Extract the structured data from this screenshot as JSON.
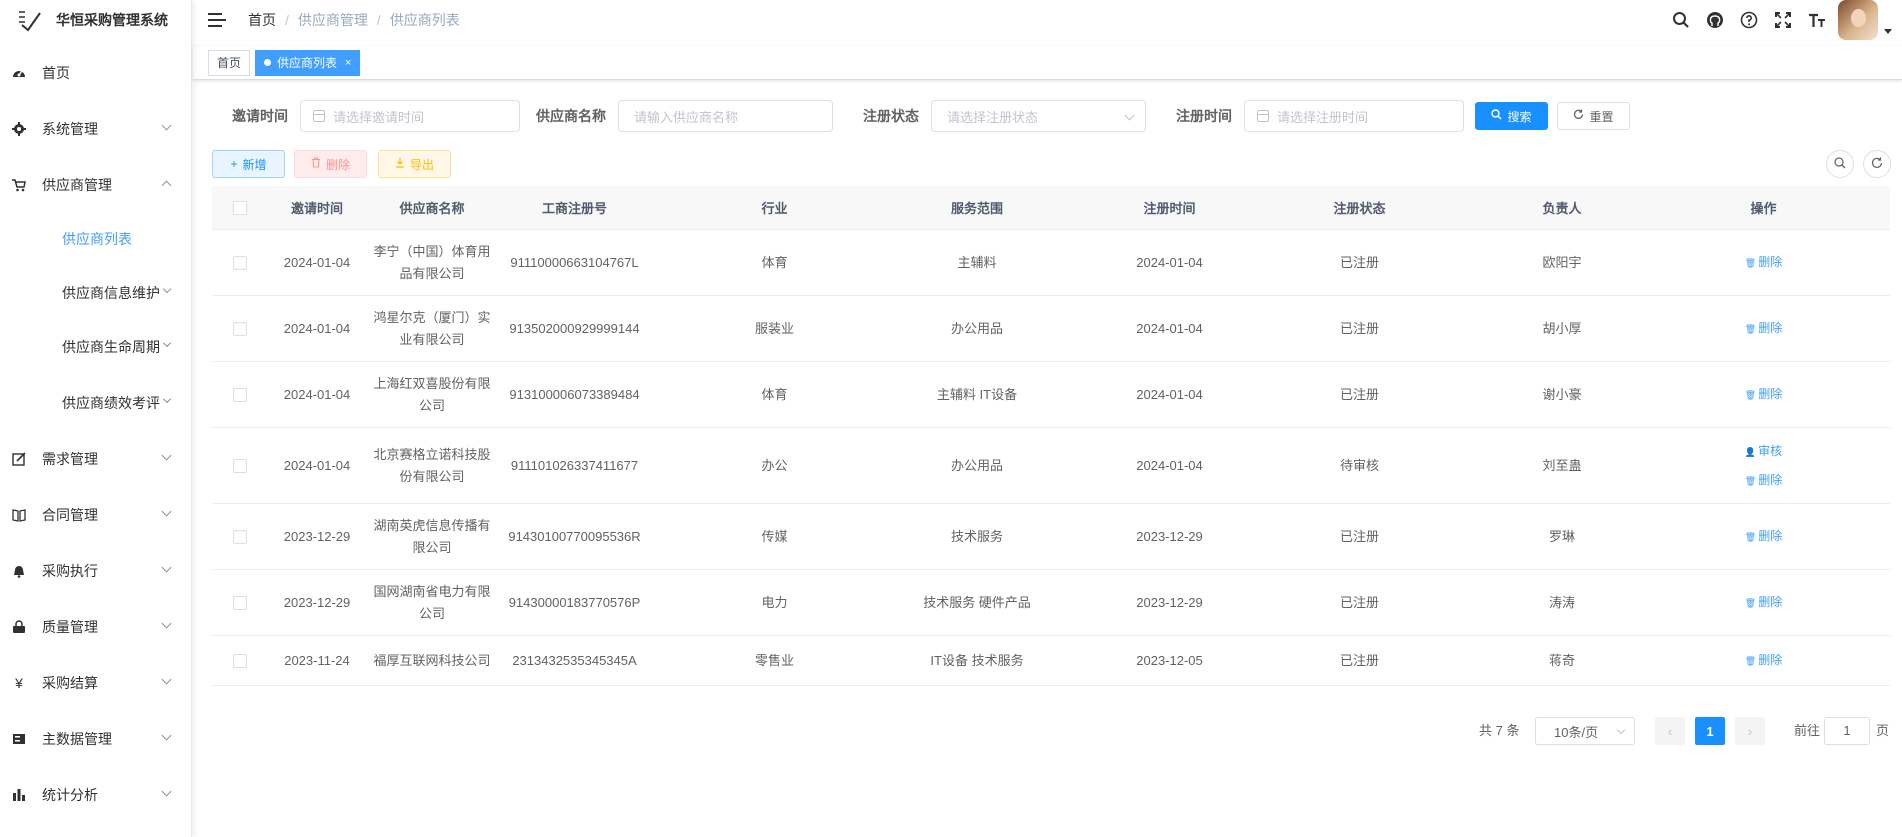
{
  "app": {
    "title": "华恒采购管理系统"
  },
  "sidebar": {
    "items": [
      {
        "label": "首页",
        "icon": "dashboard-icon"
      },
      {
        "label": "系统管理",
        "icon": "gear-icon"
      },
      {
        "label": "供应商管理",
        "icon": "cart-icon"
      },
      {
        "label": "需求管理",
        "icon": "edit-icon"
      },
      {
        "label": "合同管理",
        "icon": "book-icon"
      },
      {
        "label": "采购执行",
        "icon": "bell-icon"
      },
      {
        "label": "质量管理",
        "icon": "lock-icon"
      },
      {
        "label": "采购结算",
        "icon": "yen-icon"
      },
      {
        "label": "主数据管理",
        "icon": "server-icon"
      },
      {
        "label": "统计分析",
        "icon": "bar-chart-icon"
      }
    ],
    "sub_items": [
      {
        "label": "供应商列表"
      },
      {
        "label": "供应商信息维护"
      },
      {
        "label": "供应商生命周期"
      },
      {
        "label": "供应商绩效考评"
      }
    ]
  },
  "header": {
    "breadcrumb": [
      "首页",
      "供应商管理",
      "供应商列表"
    ],
    "breadcrumb_sep": "/"
  },
  "tags": {
    "home": "首页",
    "active": "供应商列表",
    "close": "×"
  },
  "search": {
    "invite_time_label": "邀请时间",
    "invite_time_placeholder": "请选择邀请时间",
    "supplier_name_label": "供应商名称",
    "supplier_name_placeholder": "请输入供应商名称",
    "status_label": "注册状态",
    "status_placeholder": "请选择注册状态",
    "reg_time_label": "注册时间",
    "reg_time_placeholder": "请选择注册时间",
    "search_btn": "搜索",
    "reset_btn": "重置"
  },
  "toolbar": {
    "add": "新增",
    "delete": "删除",
    "export": "导出"
  },
  "table": {
    "columns": [
      "邀请时间",
      "供应商名称",
      "工商注册号",
      "行业",
      "服务范围",
      "注册时间",
      "注册状态",
      "负责人",
      "操作"
    ],
    "rows": [
      {
        "invite": "2024-01-04",
        "name": "李宁（中国）体育用品有限公司",
        "reg_no": "91110000663104767L",
        "industry": "体育",
        "scope": "主辅料",
        "reg_time": "2024-01-04",
        "status": "已注册",
        "owner": "欧阳宇",
        "ops": [
          "删除"
        ]
      },
      {
        "invite": "2024-01-04",
        "name": "鸿星尔克（厦门）实业有限公司",
        "reg_no": "913502000929999144",
        "industry": "服装业",
        "scope": "办公用品",
        "reg_time": "2024-01-04",
        "status": "已注册",
        "owner": "胡小厚",
        "ops": [
          "删除"
        ]
      },
      {
        "invite": "2024-01-04",
        "name": "上海红双喜股份有限公司",
        "reg_no": "913100006073389484",
        "industry": "体育",
        "scope": "主辅料 IT设备",
        "reg_time": "2024-01-04",
        "status": "已注册",
        "owner": "谢小豪",
        "ops": [
          "删除"
        ]
      },
      {
        "invite": "2024-01-04",
        "name": "北京赛格立诺科技股份有限公司",
        "reg_no": "91110102633741167​7",
        "industry": "办公",
        "scope": "办公用品",
        "reg_time": "2024-01-04",
        "status": "待审核",
        "owner": "刘至蛊",
        "ops": [
          "审核",
          "删除"
        ]
      },
      {
        "invite": "2023-12-29",
        "name": "湖南英虎信息传播有限公司",
        "reg_no": "91430100770095536R",
        "industry": "传媒",
        "scope": "技术服务",
        "reg_time": "2023-12-29",
        "status": "已注册",
        "owner": "罗琳",
        "ops": [
          "删除"
        ]
      },
      {
        "invite": "2023-12-29",
        "name": "国网湖南省电力有限公司",
        "reg_no": "91430000183770576P",
        "industry": "电力",
        "scope": "技术服务 硬件产品",
        "reg_time": "2023-12-29",
        "status": "已注册",
        "owner": "涛涛",
        "ops": [
          "删除"
        ]
      },
      {
        "invite": "2023-11-24",
        "name": "福厚互联网科技公司",
        "reg_no": "2313432535345345A",
        "industry": "零售业",
        "scope": "IT设备 技术服务",
        "reg_time": "2023-12-05",
        "status": "已注册",
        "owner": "蒋奇",
        "ops": [
          "删除"
        ]
      }
    ]
  },
  "pagination": {
    "total": "共 7 条",
    "page_size": "10条/页",
    "current": "1",
    "goto_label": "前往",
    "goto_value": "1",
    "page_suffix": "页"
  },
  "colors": {
    "primary": "#1890ff",
    "link": "#409eff"
  }
}
